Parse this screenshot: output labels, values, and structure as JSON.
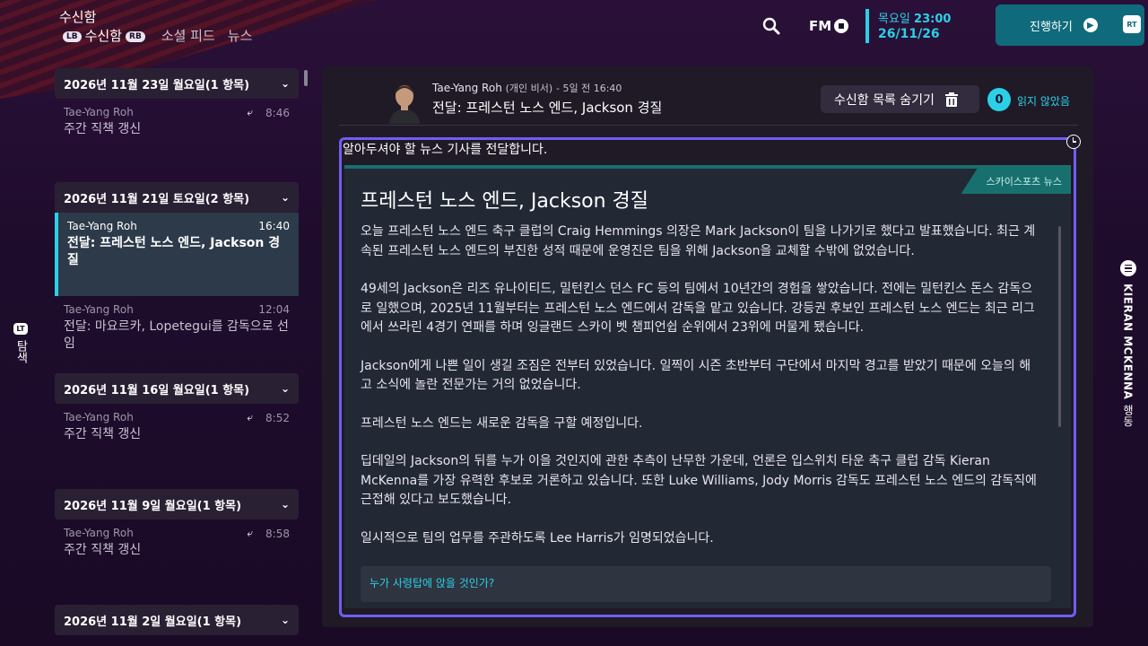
{
  "header": {
    "title": "수신함",
    "tabs": [
      {
        "key": "LB",
        "label": "수신함",
        "suffix_key": "RB"
      },
      {
        "label": "소셜 피드"
      },
      {
        "label": "뉴스"
      }
    ],
    "date": {
      "day": "목요일",
      "time": "23:00",
      "date": "26/11/26"
    },
    "continue_label": "진행하기",
    "continue_key": "RT",
    "fm_logo": "FM"
  },
  "left_nav": {
    "key": "LT",
    "label": "탐색"
  },
  "right_nav": {
    "name": "KIERAN MCKENNA",
    "label": "행동"
  },
  "message_groups": [
    {
      "header": "2026년 11월 23일 월요일(1 항목)",
      "items": [
        {
          "sender": "Tae-Yang Roh",
          "time": "8:46",
          "subject": "주간 직책 갱신",
          "replied": true
        }
      ]
    },
    {
      "header": "2026년 11월 21일 토요일(2 항목)",
      "items": [
        {
          "sender": "Tae-Yang Roh",
          "time": "16:40",
          "subject": "전달: 프레스턴 노스 엔드, Jackson 경질",
          "selected": true
        },
        {
          "sender": "Tae-Yang Roh",
          "time": "12:04",
          "subject": "전달: 마요르카, Lopetegui를 감독으로 선임"
        }
      ]
    },
    {
      "header": "2026년 11월 16일 월요일(1 항목)",
      "items": [
        {
          "sender": "Tae-Yang Roh",
          "time": "8:52",
          "subject": "주간 직책 갱신",
          "replied": true
        }
      ]
    },
    {
      "header": "2026년 11월 9일 월요일(1 항목)",
      "items": [
        {
          "sender": "Tae-Yang Roh",
          "time": "8:58",
          "subject": "주간 직책 갱신",
          "replied": true
        }
      ]
    },
    {
      "header": "2026년 11월 2일 월요일(1 항목)",
      "items": []
    }
  ],
  "message": {
    "sender": "Tae-Yang Roh",
    "role": "(개인 비서)",
    "ago": "- 5일 전 16:40",
    "subject": "전달: 프레스턴 노스 엔드, Jackson 경질",
    "hide_label": "수신함 목록 숨기기",
    "unread_count": "0",
    "unread_label": "읽지 않았음",
    "intro": "알아두셔야 할 뉴스 기사를 전달합니다."
  },
  "article": {
    "source": "스카이스포츠 뉴스",
    "title": "프레스턴 노스 엔드, Jackson 경질",
    "paragraphs": [
      "오늘 프레스턴 노스 엔드 축구 클럽의 Craig Hemmings 의장은 Mark Jackson이 팀을 나가기로 했다고 발표했습니다. 최근 계속된 프레스턴 노스 엔드의 부진한 성적 때문에 운영진은 팀을 위해 Jackson을 교체할 수밖에 없었습니다.",
      "49세의 Jackson은 리즈 유나이티드, 밀턴킨스 던스 FC 등의 팀에서 10년간의 경험을 쌓았습니다. 전에는 밀턴킨스 돈스 감독으로 일했으며, 2025년 11월부터는 프레스턴 노스 엔드에서 감독을 맡고 있습니다. 강등권 후보인 프레스턴 노스 엔드는 최근 리그에서 쓰라린 4경기 연패를 하며 잉글랜드 스카이 벳 챔피언쉽 순위에서 23위에 머물게 됐습니다.",
      "Jackson에게 나쁜 일이 생길 조짐은 전부터 있었습니다. 일찍이 시즌 초반부터 구단에서 마지막 경고를 받았기 때문에 오늘의 해고 소식에 놀란 전문가는 거의 없었습니다.",
      "프레스턴 노스 엔드는 새로운 감독을 구할 예정입니다.",
      "딥데일의 Jackson의 뒤를 누가 이을 것인지에 관한 추측이 난무한 가운데, 언론은 입스위치 타운 축구 클럽 감독 Kieran McKenna를 가장 유력한 후보로 거론하고 있습니다.  또한 Luke Williams, Jody Morris 감독도 프레스턴 노스 엔드의 감독직에 근접해 있다고 보도했습니다.",
      "일시적으로 팀의 업무를 주관하도록 Lee Harris가 임명되었습니다."
    ],
    "callout_question": "누가 사령탑에 앉을 것인가?"
  }
}
